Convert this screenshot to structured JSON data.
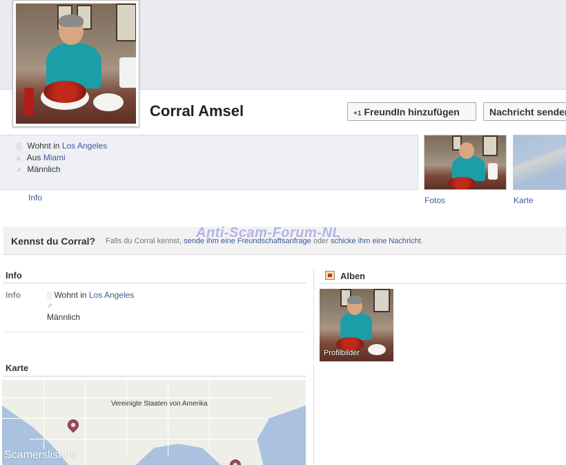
{
  "profile": {
    "name": "Corral Amsel",
    "add_friend_label": "FreundIn hinzufügen",
    "message_label": "Nachricht senden"
  },
  "about": {
    "lives_prefix": "Wohnt in",
    "lives_city": "Los Angeles",
    "from_prefix": "Aus",
    "from_city": "Miami",
    "gender": "Männlich",
    "info_link": "Info"
  },
  "thumbs": {
    "photos_label": "Fotos",
    "map_label": "Karte"
  },
  "know": {
    "title": "Kennst du Corral?",
    "text_pre": "Falls du Corral kennst,",
    "link_request": "sende ihm eine Freundschaftsanfrage",
    "text_mid": "oder",
    "link_message": "schicke ihm eine Nachricht",
    "text_end": "."
  },
  "info_section": {
    "title": "Info",
    "key": "Info",
    "lives_prefix": "Wohnt in",
    "lives_city": "Los Angeles",
    "gender": "Männlich"
  },
  "map_section": {
    "title": "Karte",
    "country_label": "Vereinigte Staaten von Amerika"
  },
  "albums": {
    "title": "Alben",
    "album_caption": "Profilbilder"
  },
  "watermarks": {
    "forum": "Anti-Scam-Forum-NL",
    "site": "Scamerslist.de"
  },
  "colors": {
    "link": "#3b5998",
    "cover_bg": "#e9ebf1",
    "info_bg": "#eef0f5",
    "map_water": "#aac2e0",
    "pin": "#9a4c62"
  },
  "icons": [
    "location-icon",
    "home-icon",
    "gender-icon",
    "add-friend-icon",
    "album-icon",
    "map-pin-icon"
  ]
}
